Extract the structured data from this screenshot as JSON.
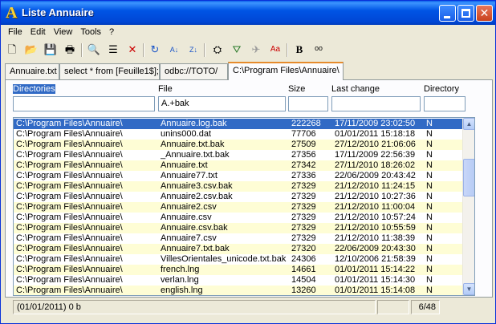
{
  "window": {
    "title": "Liste Annuaire",
    "app_icon_letter": "A",
    "close_glyph": "✕"
  },
  "menu": [
    "File",
    "Edit",
    "View",
    "Tools",
    "?"
  ],
  "toolbar": [
    "new-icon",
    "open-icon",
    "save-icon",
    "print-icon",
    "find-icon",
    "list-view-icon",
    "delete-icon",
    "refresh-icon",
    "sort-az-icon",
    "sort-za-icon",
    "binoculars-icon",
    "filter-icon",
    "remove-filter-icon",
    "case-icon",
    "bold-icon",
    "glasses-icon"
  ],
  "toolbar_glyphs": [
    "🗋",
    "📂",
    "💾",
    "🖶",
    "🔍",
    "☰",
    "✕",
    "↻",
    "A↓",
    "Z↓",
    "⛭",
    "⛛",
    "✈",
    "Aa",
    "B",
    "ᵒᵒ"
  ],
  "tabs": [
    "Annuaire.txt",
    "select * from [Feuille1$];",
    "odbc://TOTO/",
    "C:\\Program Files\\Annuaire\\"
  ],
  "columns": {
    "directories": "Directories",
    "file": "File",
    "size": "Size",
    "last_change": "Last change",
    "directory": "Directory"
  },
  "filters": {
    "directories": "",
    "file": "A.+bak",
    "size": "",
    "last_change": "",
    "directory": ""
  },
  "rows": [
    [
      "C:\\Program Files\\Annuaire\\",
      "Annuaire.log.bak",
      "222268",
      "17/11/2009 23:02:50",
      "N"
    ],
    [
      "C:\\Program Files\\Annuaire\\",
      "unins000.dat",
      "77706",
      "01/01/2011 15:18:18",
      "N"
    ],
    [
      "C:\\Program Files\\Annuaire\\",
      "Annuaire.txt.bak",
      "27509",
      "27/12/2010 21:06:06",
      "N"
    ],
    [
      "C:\\Program Files\\Annuaire\\",
      "_Annuaire.txt.bak",
      "27356",
      "17/11/2009 22:56:39",
      "N"
    ],
    [
      "C:\\Program Files\\Annuaire\\",
      "Annuaire.txt",
      "27342",
      "27/11/2010 18:26:02",
      "N"
    ],
    [
      "C:\\Program Files\\Annuaire\\",
      "Annuaire77.txt",
      "27336",
      "22/06/2009 20:43:42",
      "N"
    ],
    [
      "C:\\Program Files\\Annuaire\\",
      "Annuaire3.csv.bak",
      "27329",
      "21/12/2010 11:24:15",
      "N"
    ],
    [
      "C:\\Program Files\\Annuaire\\",
      "Annuaire2.csv.bak",
      "27329",
      "21/12/2010 10:27:36",
      "N"
    ],
    [
      "C:\\Program Files\\Annuaire\\",
      "Annuaire2.csv",
      "27329",
      "21/12/2010 11:00:04",
      "N"
    ],
    [
      "C:\\Program Files\\Annuaire\\",
      "Annuaire.csv",
      "27329",
      "21/12/2010 10:57:24",
      "N"
    ],
    [
      "C:\\Program Files\\Annuaire\\",
      "Annuaire.csv.bak",
      "27329",
      "21/12/2010 10:55:59",
      "N"
    ],
    [
      "C:\\Program Files\\Annuaire\\",
      "Annuaire7.csv",
      "27329",
      "21/12/2010 11:38:39",
      "N"
    ],
    [
      "C:\\Program Files\\Annuaire\\",
      "Annuaire7.txt.bak",
      "27320",
      "22/06/2009 20:43:30",
      "N"
    ],
    [
      "C:\\Program Files\\Annuaire\\",
      "VillesOrientales_unicode.txt.bak",
      "24306",
      "12/10/2006 21:58:39",
      "N"
    ],
    [
      "C:\\Program Files\\Annuaire\\",
      "french.lng",
      "14661",
      "01/01/2011 15:14:22",
      "N"
    ],
    [
      "C:\\Program Files\\Annuaire\\",
      "verlan.lng",
      "14504",
      "01/01/2011 15:14:30",
      "N"
    ],
    [
      "C:\\Program Files\\Annuaire\\",
      "english.lng",
      "13260",
      "01/01/2011 15:14:08",
      "N"
    ]
  ],
  "scrollbar": {
    "up_glyph": "▲",
    "down_glyph": "▼"
  },
  "status": {
    "left": "(01/01/2011) 0 b",
    "middle": "",
    "right": "6/48"
  }
}
